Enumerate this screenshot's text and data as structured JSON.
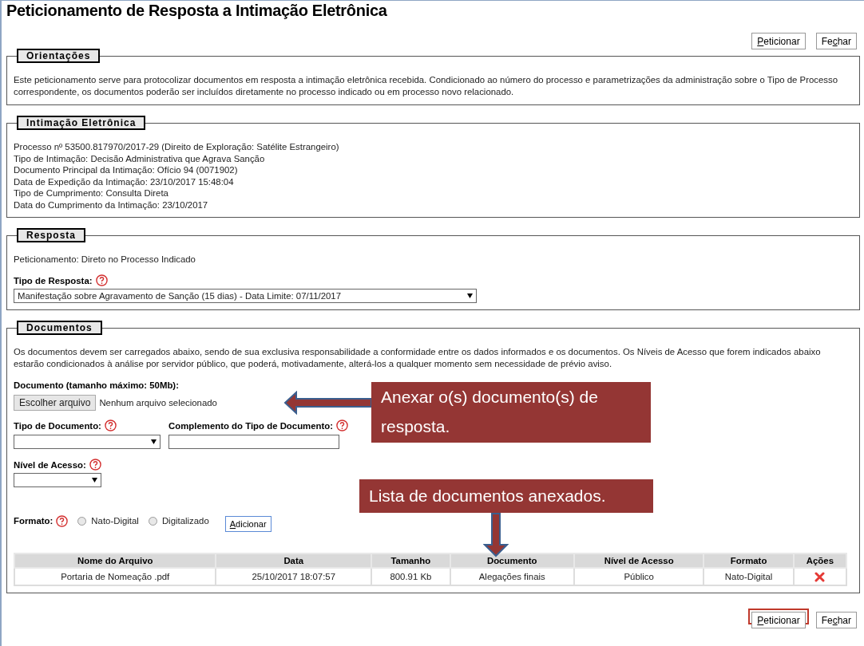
{
  "page": {
    "title": "Peticionamento de Resposta a Intimação Eletrônica"
  },
  "top_buttons": [
    {
      "accesskey": "P",
      "accesskey_after": "eticionar",
      "highlighted": false
    },
    {
      "accesskey_before": "Fe",
      "accesskey": "c",
      "accesskey_after": "har",
      "highlighted": false
    }
  ],
  "orientacoes": {
    "legend": "Orientações",
    "text": "Este peticionamento serve para protocolizar documentos em resposta a intimação eletrônica recebida. Condicionado ao número do processo e parametrizações da administração sobre o Tipo de Processo correspondente, os documentos poderão ser incluídos diretamente no processo indicado ou em processo novo relacionado."
  },
  "intimacao": {
    "legend": "Intimação Eletrônica",
    "lines": [
      "Processo nº 53500.817970/2017-29 (Direito de Exploração: Satélite Estrangeiro)",
      "Tipo de Intimação: Decisão Administrativa que Agrava Sanção",
      "Documento Principal da Intimação: Ofício 94 (0071902)",
      "Data de Expedição da Intimação: 23/10/2017 15:48:04",
      "Tipo de Cumprimento: Consulta Direta",
      "Data do Cumprimento da Intimação: 23/10/2017"
    ]
  },
  "resposta": {
    "legend": "Resposta",
    "peticionamento": "Peticionamento: Direto no Processo Indicado",
    "tipo_label": "Tipo de Resposta:",
    "tipo_value": "Manifestação sobre Agravamento de Sanção (15 dias) - Data Limite: 07/11/2017"
  },
  "documentos": {
    "legend": "Documentos",
    "text": "Os documentos devem ser carregados abaixo, sendo de sua exclusiva responsabilidade a conformidade entre os dados informados e os documentos. Os Níveis de Acesso que forem indicados abaixo estarão condicionados à análise por servidor público, que poderá, motivadamente, alterá-los a qualquer momento sem necessidade de prévio aviso.",
    "file_label": "Documento (tamanho máximo: 50Mb):",
    "file_button": "Escolher arquivo",
    "file_status": "Nenhum arquivo selecionado",
    "tipo_label": "Tipo de Documento:",
    "complemento_label": "Complemento do Tipo de Documento:",
    "nivel_label": "Nível de Acesso:",
    "formato_label": "Formato:",
    "formato_options": [
      {
        "label": "Nato-Digital",
        "selected": false
      },
      {
        "label": "Digitalizado",
        "selected": false
      }
    ],
    "add_button": {
      "accesskey": "A",
      "accesskey_after": "dicionar"
    },
    "table": {
      "columns": [
        "Nome do Arquivo",
        "Data",
        "Tamanho",
        "Documento",
        "Nível de Acesso",
        "Formato",
        "Ações"
      ],
      "rows": [
        {
          "cells": [
            "Portaria de Nomeação .pdf",
            "25/10/2017 18:07:57",
            "800.91 Kb",
            "Alegações finais",
            "Público",
            "Nato-Digital"
          ]
        }
      ]
    }
  },
  "bottom_buttons": [
    {
      "accesskey": "P",
      "accesskey_after": "eticionar",
      "highlighted": true
    },
    {
      "accesskey_before": "Fe",
      "accesskey": "c",
      "accesskey_after": "har",
      "highlighted": false
    }
  ],
  "callouts": [
    {
      "text": "Anexar o(s) documento(s) de resposta.",
      "kind": "left"
    },
    {
      "text": "Lista de documentos anexados.",
      "kind": "down"
    }
  ]
}
